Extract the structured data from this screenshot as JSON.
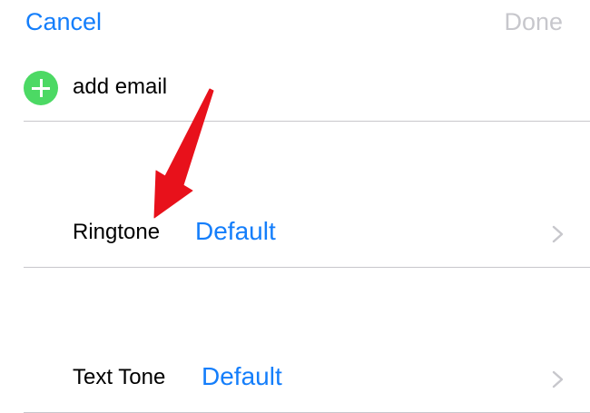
{
  "nav": {
    "cancel_label": "Cancel",
    "done_label": "Done"
  },
  "add_email": {
    "label": "add email",
    "icon": "plus-circle-icon"
  },
  "rows": [
    {
      "label": "Ringtone",
      "value": "Default",
      "icon": "chevron-right-icon"
    },
    {
      "label": "Text Tone",
      "value": "Default",
      "icon": "chevron-right-icon"
    }
  ],
  "annotation": {
    "icon": "red-arrow-icon",
    "color": "#e8111b"
  },
  "colors": {
    "accent": "#147efb",
    "disabled": "#c7c7cc",
    "add_green": "#4cd964",
    "separator": "#c8c7cc",
    "chevron": "#c7c7cc"
  }
}
